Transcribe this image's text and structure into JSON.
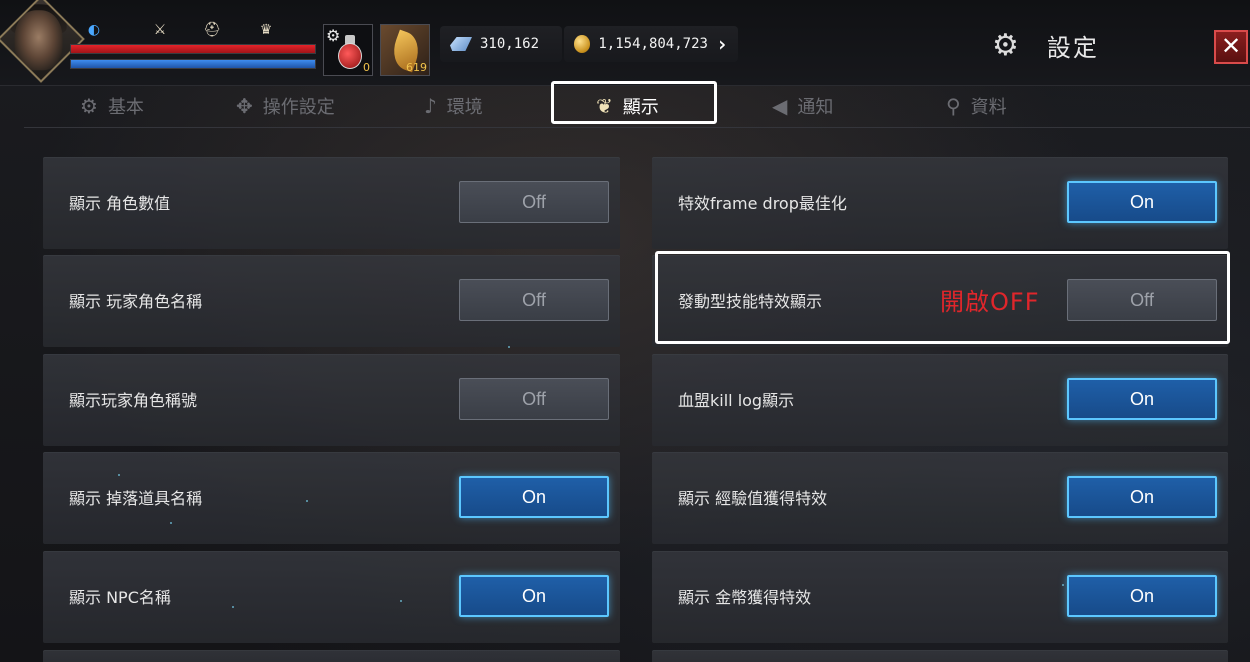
{
  "hud": {
    "hp_fraction": 1.0,
    "mp_fraction": 1.0,
    "potion_count": "0",
    "leaf_count": "619",
    "crystal_amount": "310,162",
    "gold_amount": "1,154,804,723",
    "settings_title": "設定",
    "close_label": "✕"
  },
  "tabs": [
    {
      "label": "基本",
      "icon": "gear-icon"
    },
    {
      "label": "操作設定",
      "icon": "dpad-icon"
    },
    {
      "label": "環境",
      "icon": "music-note-icon"
    },
    {
      "label": "顯示",
      "icon": "display-icon",
      "active": true
    },
    {
      "label": "通知",
      "icon": "megaphone-icon"
    },
    {
      "label": "資料",
      "icon": "profile-icon"
    }
  ],
  "settings_left": [
    {
      "label": "顯示 角色數值",
      "state": "Off"
    },
    {
      "label": "顯示 玩家角色名稱",
      "state": "Off"
    },
    {
      "label": "顯示玩家角色稱號",
      "state": "Off"
    },
    {
      "label": "顯示 掉落道具名稱",
      "state": "On"
    },
    {
      "label": "顯示 NPC名稱",
      "state": "On"
    }
  ],
  "settings_right": [
    {
      "label": "特效frame drop最佳化",
      "state": "On"
    },
    {
      "label": "發動型技能特效顯示",
      "state": "Off"
    },
    {
      "label": "血盟kill log顯示",
      "state": "On"
    },
    {
      "label": "顯示 經驗值獲得特效",
      "state": "On"
    },
    {
      "label": "顯示 金幣獲得特效",
      "state": "On"
    }
  ],
  "annotation": "開啟OFF",
  "colors": {
    "on_toggle": "#1f5fa8",
    "on_border": "#5cc7ff",
    "off_toggle": "#4a4e57",
    "annotation": "#e0262b",
    "highlight_box": "#ffffff"
  }
}
